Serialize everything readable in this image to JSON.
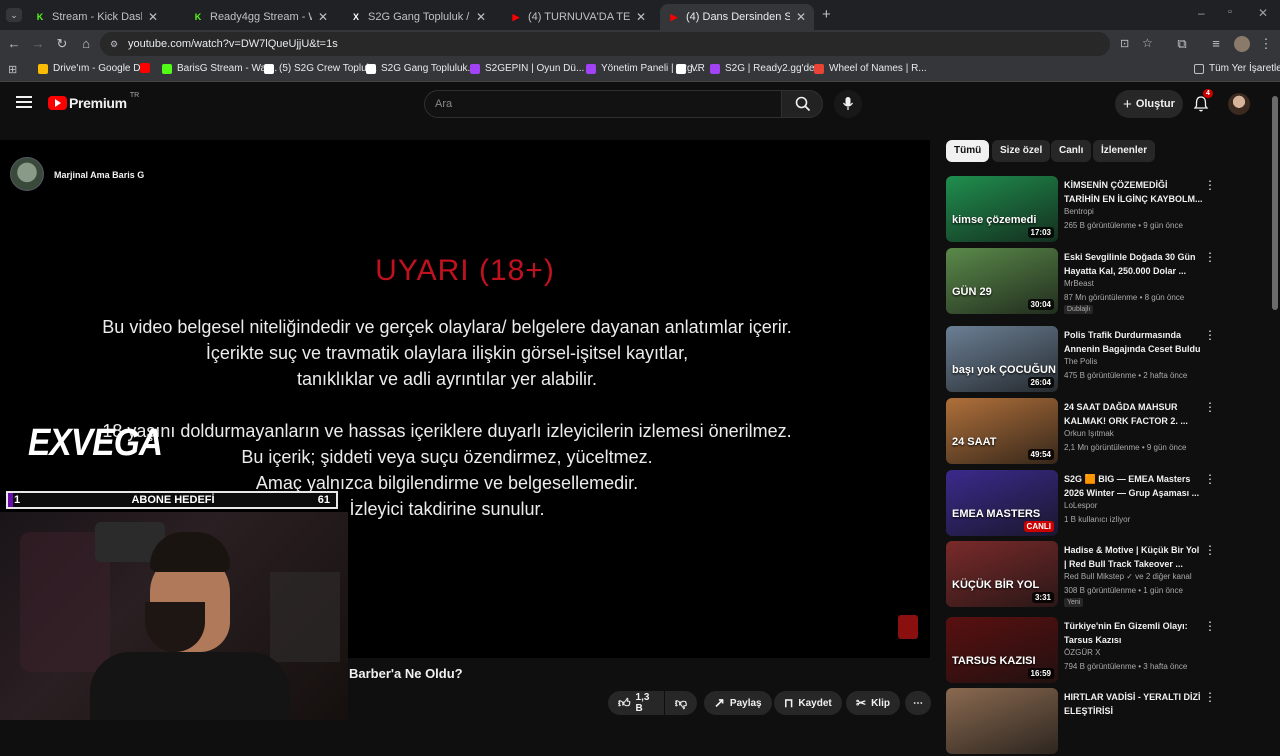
{
  "browser": {
    "tabs": [
      {
        "title": "Stream - Kick Dashboard",
        "icon": "K",
        "color": "#53fc18"
      },
      {
        "title": "Ready4gg Stream - Watch Live",
        "icon": "K",
        "color": "#53fc18"
      },
      {
        "title": "S2G Gang Topluluk / X",
        "icon": "X",
        "color": "#ffffff"
      },
      {
        "title": "(4) TURNUVA'DA TEK BAŞIMA...",
        "icon": "▶",
        "color": "#ff0000"
      },
      {
        "title": "(4) Dans Dersinden Sonra Orta...",
        "icon": "▶",
        "color": "#ff0000"
      }
    ],
    "url": "youtube.com/watch?v=DW7lQueUjjU&t=1s",
    "bookmarks": [
      {
        "label": "Drive'ım - Google D...",
        "color": "#fbbc04"
      },
      {
        "label": "",
        "color": "#ff0000"
      },
      {
        "label": "BarisG Stream - Wat...",
        "color": "#53fc18"
      },
      {
        "label": "(5) S2G Crew Toplul...",
        "color": "#ffffff"
      },
      {
        "label": "S2G Gang Topluluk...",
        "color": "#ffffff"
      },
      {
        "label": "S2GEPIN | Oyun Dü...",
        "color": "#a142f4"
      },
      {
        "label": "Yönetim Paneli | s2g...",
        "color": "#a142f4"
      },
      {
        "label": "VR",
        "color": "#ffffff"
      },
      {
        "label": "S2G | Ready2.gg'de...",
        "color": "#a142f4"
      },
      {
        "label": "Wheel of Names | R...",
        "color": "#ea4335"
      }
    ],
    "all_bookmarks": "Tüm Yer İşaretleri"
  },
  "youtube": {
    "logo_text": "Premium",
    "logo_region": "TR",
    "search_placeholder": "Ara",
    "create_label": "Oluştur",
    "notif_count": "4"
  },
  "player": {
    "channel_name": "Marjinal Ama Baris G",
    "warning_title": "UYARI (18+)",
    "warning_lines": [
      "Bu video belgesel niteliğindedir ve gerçek olaylara/ belgelere dayanan anlatımlar içerir.",
      "İçerikte suç ve travmatik olaylara ilişkin görsel-işitsel kayıtlar,",
      "tanıklıklar ve adli ayrıntılar yer alabilir.",
      "18 yaşını doldurmayanların ve hassas içeriklere duyarlı izleyicilerin izlemesi önerilmez.",
      "Bu içerik; şiddeti veya suçu özendirmez, yüceltmez.",
      "Amaç yalnızca bilgilendirme ve belgesellemedir.",
      "İzleyici takdirine sunulur."
    ]
  },
  "overlay": {
    "brand": "EXVEGA",
    "goal_label": "ABONE HEDEFİ",
    "goal_current": "1",
    "goal_target": "61",
    "goal_progress": 0.016
  },
  "video_title": "Barber'a Ne Oldu?",
  "actions": {
    "likes": "1,3 B",
    "share": "Paylaş",
    "save": "Kaydet",
    "clip": "Klip"
  },
  "chips": [
    "Tümü",
    "Size özel",
    "Canlı",
    "İzlenenler"
  ],
  "recommendations": [
    {
      "title": "KİMSENİN ÇÖZEMEDİĞİ TARİHİN EN İLGİNÇ KAYBOLM...",
      "channel": "Bentropi",
      "meta": "265 B görüntülenme • 9 gün önce",
      "duration": "17:03",
      "thumb": "#1f8f4e",
      "thumb_text": "kimse çözemedi"
    },
    {
      "title": "Eski Sevgilinle Doğada 30 Gün Hayatta Kal, 250.000 Dolar ...",
      "channel": "MrBeast",
      "meta": "87 Mn görüntülenme • 8 gün önce",
      "duration": "30:04",
      "thumb": "#5a8a4a",
      "thumb_text": "GÜN 29",
      "badge": "Dublajlı"
    },
    {
      "title": "Polis Trafik Durdurmasında Annenin Bagajında Ceset Buldu",
      "channel": "The Polis",
      "meta": "475 B görüntülenme • 2 hafta önce",
      "duration": "26:04",
      "thumb": "#6b7f94",
      "thumb_text": "başı yok ÇOCUĞUN"
    },
    {
      "title": "24 SAAT DAĞDA MAHSUR KALMAK! ORK FACTOR 2. ...",
      "channel": "Orkun Işıtmak",
      "meta": "2,1 Mn görüntülenme • 9 gün önce",
      "duration": "49:54",
      "thumb": "#b0703a",
      "thumb_text": "24 SAAT"
    },
    {
      "title": "S2G 🟧 BIG — EMEA Masters 2026 Winter — Grup Aşaması ...",
      "channel": "LoLespor",
      "meta": "1 B kullanıcı izliyor",
      "duration": "CANLI",
      "thumb": "#3b2a8c",
      "thumb_text": "EMEA MASTERS"
    },
    {
      "title": "Hadise & Motive | Küçük Bir Yol | Red Bull Track Takeover ...",
      "channel": "Red Bull Mikstep ✓ ve 2 diğer kanal",
      "meta": "308 B görüntülenme • 1 gün önce",
      "duration": "3:31",
      "thumb": "#7a2a2a",
      "thumb_text": "KÜÇÜK BİR YOL",
      "badge": "Yeni"
    },
    {
      "title": "Türkiye'nin En Gizemli Olayı: Tarsus Kazısı",
      "channel": "ÖZGÜR X",
      "meta": "794 B görüntülenme • 3 hafta önce",
      "duration": "16:59",
      "thumb": "#5a1010",
      "thumb_text": "TARSUS KAZISI"
    },
    {
      "title": "HIRTLAR VADİSİ - YERALTI DİZİ ELEŞTİRİSİ",
      "channel": "",
      "meta": "",
      "duration": "",
      "thumb": "#8a6a50",
      "thumb_text": ""
    }
  ]
}
